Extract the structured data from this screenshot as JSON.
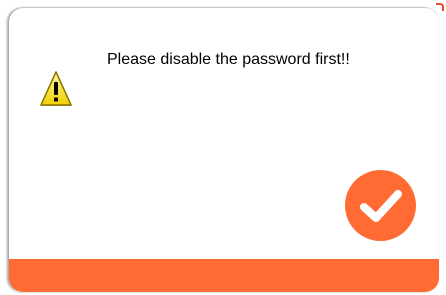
{
  "dialog": {
    "message": "Please disable the password first!!",
    "icon": "warning-icon",
    "ok_icon": "checkmark-icon",
    "accent_color": "#ff6b33"
  }
}
